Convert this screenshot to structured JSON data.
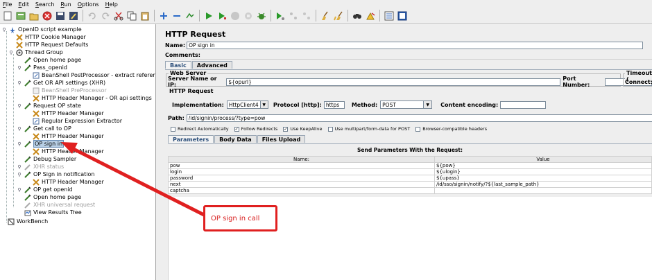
{
  "menu": [
    "File",
    "Edit",
    "Search",
    "Run",
    "Options",
    "Help"
  ],
  "toolbar": [
    "new-icon",
    "templates-icon",
    "open-icon",
    "close-icon",
    "save-icon",
    "save-as-icon",
    "cut-icon",
    "copy-icon",
    "paste-icon",
    "expand-icon",
    "collapse-icon",
    "toggle-icon",
    "start-icon",
    "start-no-pause-icon",
    "stop-icon",
    "shutdown-icon",
    "clear-icon",
    "remote-start-icon",
    "remote-stop-icon",
    "remote-exit-icon",
    "broom-icon",
    "clear-all-icon",
    "search-icon",
    "reset-search-icon",
    "function-helper-icon",
    "help-icon"
  ],
  "tree": [
    {
      "label": "OpenID script example",
      "state": "normal"
    },
    {
      "label": "HTTP Cookie Manager",
      "state": "normal"
    },
    {
      "label": "HTTP Request Defaults",
      "state": "normal"
    },
    {
      "label": "Thread Group",
      "state": "normal"
    },
    {
      "label": "Open home page",
      "state": "normal"
    },
    {
      "label": "Pass_openid",
      "state": "normal"
    },
    {
      "label": "BeanShell PostProcessor - extract referer",
      "state": "normal"
    },
    {
      "label": "Get OR API settings (XHR)",
      "state": "normal"
    },
    {
      "label": "BeanShell PreProcessor",
      "state": "disabled"
    },
    {
      "label": "HTTP Header Manager - OR api settings",
      "state": "normal"
    },
    {
      "label": "Request OP state",
      "state": "normal"
    },
    {
      "label": "HTTP Header Manager",
      "state": "normal"
    },
    {
      "label": "Regular Expression Extractor",
      "state": "normal"
    },
    {
      "label": "Get call to OP",
      "state": "normal"
    },
    {
      "label": "HTTP Header Manager",
      "state": "normal"
    },
    {
      "label": "OP sign in",
      "state": "selected"
    },
    {
      "label": "HTTP Header Manager",
      "state": "normal"
    },
    {
      "label": "Debug Sampler",
      "state": "normal"
    },
    {
      "label": "XHR status",
      "state": "disabled"
    },
    {
      "label": "OP Sign in notification",
      "state": "normal"
    },
    {
      "label": "HTTP Header Manager",
      "state": "normal"
    },
    {
      "label": "OP get openid",
      "state": "normal"
    },
    {
      "label": "Open home page",
      "state": "normal"
    },
    {
      "label": "XHR universal request",
      "state": "disabled"
    },
    {
      "label": "View Results Tree",
      "state": "normal"
    },
    {
      "label": "WorkBench",
      "state": "normal"
    }
  ],
  "panel": {
    "title": "HTTP Request",
    "name_label": "Name:",
    "name_value": "OP sign in",
    "comments_label": "Comments:",
    "tab_basic": "Basic",
    "tab_advanced": "Advanced",
    "web_server": "Web Server",
    "server_label": "Server Name or IP:",
    "server_value": "${opurl}",
    "port_label": "Port Number:",
    "port_value": "",
    "timeouts": "Timeouts (",
    "connect_label": "Connect:",
    "http_request": "HTTP Request",
    "impl_label": "Implementation:",
    "impl_value": "HttpClient4",
    "protocol_label": "Protocol [http]:",
    "protocol_value": "https",
    "method_label": "Method:",
    "method_value": "POST",
    "encoding_label": "Content encoding:",
    "encoding_value": "",
    "path_label": "Path:",
    "path_value": "/id/signin/process/?type=pow",
    "checkboxes": [
      {
        "label": "Redirect Automatically",
        "checked": false
      },
      {
        "label": "Follow Redirects",
        "checked": true
      },
      {
        "label": "Use KeepAlive",
        "checked": true
      },
      {
        "label": "Use multipart/form-data for POST",
        "checked": false
      },
      {
        "label": "Browser-compatible headers",
        "checked": false
      }
    ],
    "subtabs": [
      "Parameters",
      "Body Data",
      "Files Upload"
    ],
    "send_params": "Send Parameters With the Request:",
    "col_name": "Name:",
    "col_value": "Value",
    "params": [
      {
        "name": "pow",
        "value": "${pow}"
      },
      {
        "name": "login",
        "value": "${ulogin}"
      },
      {
        "name": "password",
        "value": "${upass}"
      },
      {
        "name": "next",
        "value": "/id/sso/signin/notify/?${last_sample_path}"
      },
      {
        "name": "captcha",
        "value": ""
      }
    ]
  },
  "annotation": "OP sign in call",
  "colors": {
    "annotation": "#e02020",
    "selection": "#b8cfe5"
  }
}
